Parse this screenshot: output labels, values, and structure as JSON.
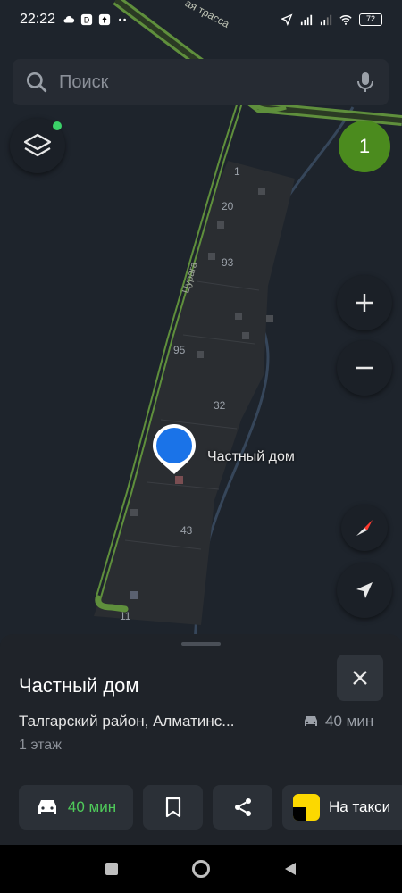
{
  "status_bar": {
    "time": "22:22",
    "battery": "72"
  },
  "search": {
    "placeholder": "Поиск"
  },
  "map": {
    "badge_count": "1",
    "pin_label": "Частный дом",
    "street_name": "Цурага",
    "road_label": "ая трасса",
    "house_numbers": [
      "1",
      "20",
      "93",
      "95",
      "32",
      "43",
      "11"
    ]
  },
  "sheet": {
    "title": "Частный дом",
    "address": "Талгарский район, Алматинс...",
    "eta": "40 мин",
    "floors": "1 этаж",
    "actions": {
      "route_eta": "40 мин",
      "taxi_label": "На такси"
    }
  },
  "colors": {
    "accent_green": "#4fcb5a",
    "pin_blue": "#1a73e8",
    "badge_green": "#4b8b1e"
  }
}
